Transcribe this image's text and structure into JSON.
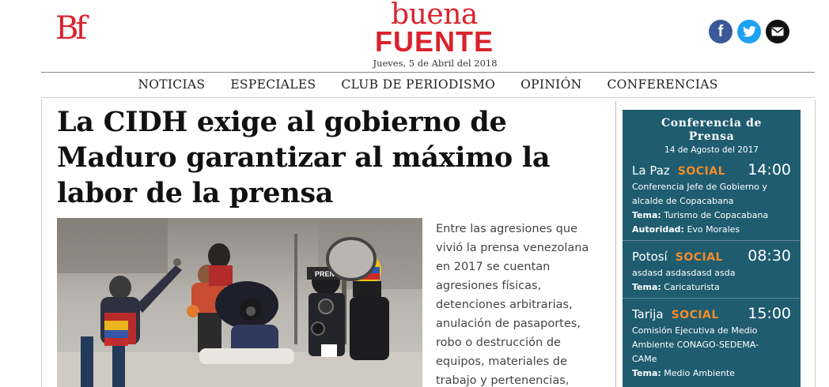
{
  "header": {
    "logo_monogram": "Bf",
    "brand_line1": "buena",
    "brand_line2": "FUENTE",
    "date": "Jueves, 5 de Abril del 2018"
  },
  "social": {
    "facebook_icon": "facebook-icon",
    "twitter_icon": "twitter-icon",
    "mail_icon": "mail-icon"
  },
  "nav": {
    "items": [
      {
        "label": "NOTICIAS"
      },
      {
        "label": "ESPECIALES"
      },
      {
        "label": "CLUB DE PERIODISMO"
      },
      {
        "label": "OPINIÓN"
      },
      {
        "label": "CONFERENCIAS"
      }
    ]
  },
  "article": {
    "headline": "La CIDH exige al gobierno de Maduro garantizar al máximo la labor de la prensa",
    "body_lines": [
      "Entre las agresiones que",
      "vivió la prensa venezolana",
      "en 2017 se cuentan",
      "agresiones físicas,",
      "detenciones arbitrarias,",
      "anulación de pasaportes,",
      "robo o destrucción de",
      "equipos, materiales de",
      "trabajo y pertenencias,"
    ],
    "photo_label": "PRENSA"
  },
  "sidebar": {
    "title_line1": "Conferencia de",
    "title_line2": "Prensa",
    "date": "14 de Agosto del 2017",
    "events": [
      {
        "city": "La Paz",
        "tag": "SOCIAL",
        "time": "14:00",
        "desc_lines": [
          "Conferencia Jefe de Gobierno y",
          "alcalde de Copacabana"
        ],
        "tema_label": "Tema:",
        "tema": "Turismo de Copacabana",
        "autoridad_label": "Autoridad:",
        "autoridad": "Evo Morales"
      },
      {
        "city": "Potosí",
        "tag": "SOCIAL",
        "time": "08:30",
        "desc_lines": [
          "asdasd asdasdasd asda"
        ],
        "tema_label": "Tema:",
        "tema": "Caricaturista"
      },
      {
        "city": "Tarija",
        "tag": "SOCIAL",
        "time": "15:00",
        "desc_lines": [
          "Comisión Ejecutiva de Medio",
          "Ambiente CONAGO-SEDEMA-",
          "CAMe"
        ],
        "tema_label": "Tema:",
        "tema": "Medio Ambiente"
      }
    ]
  },
  "colors": {
    "brand_red": "#d9232d",
    "panel_teal": "#1f5c70",
    "tag_orange": "#f28c28",
    "facebook": "#3b5998",
    "twitter": "#1da1f2"
  }
}
